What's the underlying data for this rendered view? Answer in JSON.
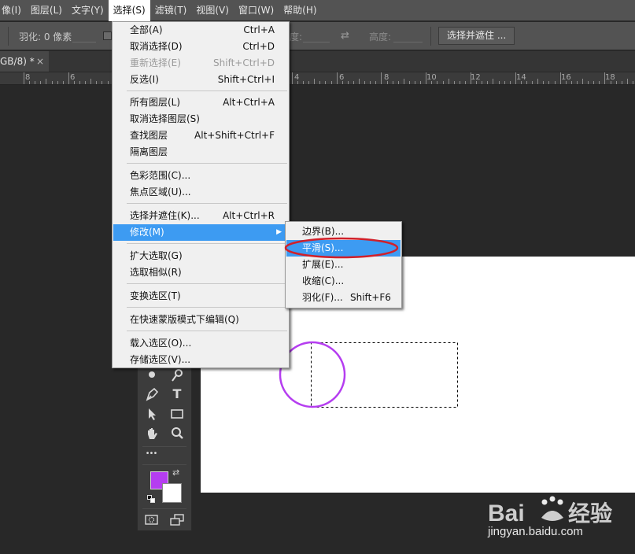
{
  "menubar": {
    "items": [
      "像(I)",
      "图层(L)",
      "文字(Y)",
      "选择(S)",
      "滤镜(T)",
      "视图(V)",
      "窗口(W)",
      "帮助(H)"
    ],
    "active_index": 3
  },
  "options_bar": {
    "feather_label": "羽化: 0 像素",
    "width_label": "度:",
    "height_label": "高度:",
    "select_mask_button": "选择并遮住 ..."
  },
  "document_tab": {
    "title": "GB/8) *",
    "close_glyph": "×"
  },
  "ruler": {
    "labels": [
      "8",
      "6",
      "4",
      "2",
      "0",
      "2",
      "4",
      "6",
      "8",
      "10",
      "12",
      "14",
      "16",
      "18"
    ]
  },
  "select_menu": {
    "items": [
      {
        "label": "全部(A)",
        "shortcut": "Ctrl+A"
      },
      {
        "label": "取消选择(D)",
        "shortcut": "Ctrl+D"
      },
      {
        "label": "重新选择(E)",
        "shortcut": "Shift+Ctrl+D",
        "disabled": true
      },
      {
        "label": "反选(I)",
        "shortcut": "Shift+Ctrl+I"
      },
      {
        "label": "所有图层(L)",
        "shortcut": "Alt+Ctrl+A"
      },
      {
        "label": "取消选择图层(S)",
        "shortcut": ""
      },
      {
        "label": "查找图层",
        "shortcut": "Alt+Shift+Ctrl+F"
      },
      {
        "label": "隔离图层",
        "shortcut": ""
      },
      {
        "label": "色彩范围(C)...",
        "shortcut": ""
      },
      {
        "label": "焦点区域(U)...",
        "shortcut": ""
      },
      {
        "label": "选择并遮住(K)...",
        "shortcut": "Alt+Ctrl+R"
      },
      {
        "label": "修改(M)",
        "shortcut": "",
        "submenu": true,
        "highlighted": true
      },
      {
        "label": "扩大选取(G)",
        "shortcut": ""
      },
      {
        "label": "选取相似(R)",
        "shortcut": ""
      },
      {
        "label": "变换选区(T)",
        "shortcut": ""
      },
      {
        "label": "在快速蒙版模式下编辑(Q)",
        "shortcut": ""
      },
      {
        "label": "载入选区(O)...",
        "shortcut": ""
      },
      {
        "label": "存储选区(V)...",
        "shortcut": ""
      }
    ],
    "submenu_arrow": "▶"
  },
  "modify_submenu": {
    "items": [
      {
        "label": "边界(B)...",
        "shortcut": ""
      },
      {
        "label": "平滑(S)...",
        "shortcut": "",
        "highlighted": true
      },
      {
        "label": "扩展(E)...",
        "shortcut": ""
      },
      {
        "label": "收缩(C)...",
        "shortcut": ""
      },
      {
        "label": "羽化(F)...",
        "shortcut": "Shift+F6"
      }
    ]
  },
  "tools": {
    "type_tool_glyph": "T",
    "more_glyph": "•••",
    "swap_glyph": "⇄",
    "foreground_color": "#b53df0",
    "background_color": "#ffffff"
  },
  "annotation": {
    "circle_color": "#b53df0",
    "ellipse_color": "#d0202a"
  },
  "watermark": {
    "brand": "Bai du 经验",
    "url": "jingyan.baidu.com"
  }
}
